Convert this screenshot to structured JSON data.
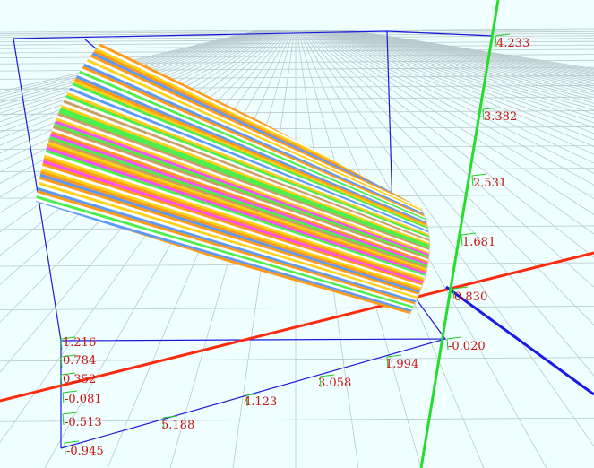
{
  "colors": {
    "background": "#f0ffff",
    "grid": "#b9c9cc",
    "box": "#1a1adf",
    "x_axis": "#ff2a10",
    "y_axis": "#22e02a",
    "z_axis": "#1a1ae6",
    "tick_text": "#cc1111",
    "tick_mark": "#22cc22"
  },
  "stripe_colors": [
    "#ff9a1a",
    "#ffffff",
    "#ffd21a",
    "#4cf04c",
    "#ff4cff",
    "#5a9aff",
    "#c8a064",
    "#ffffff",
    "#ffcc1a",
    "#ff9a1a",
    "#ffffff",
    "#4cf04c"
  ],
  "vertical_axis": {
    "ticks": [
      "4.233",
      "3.382",
      "2.531",
      "1.681",
      "0.830",
      "-0.020"
    ]
  },
  "front_axis": {
    "ticks": [
      "1.994",
      "3.058",
      "4.123",
      "5.188"
    ]
  },
  "left_axis": {
    "ticks": [
      "1.216",
      "0.784",
      "0.352",
      "-0.081",
      "-0.513",
      "-0.945"
    ]
  }
}
